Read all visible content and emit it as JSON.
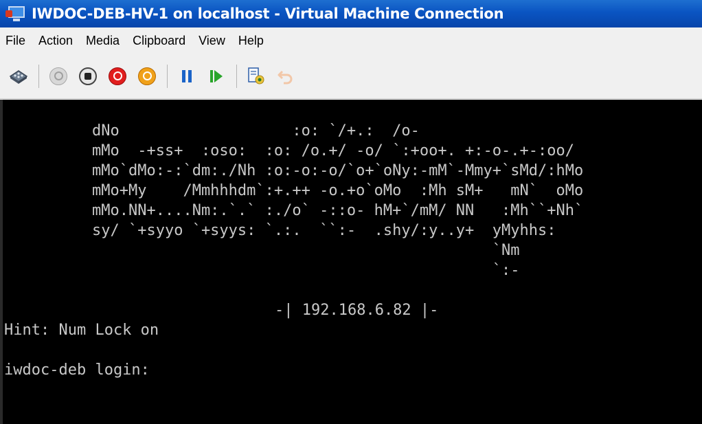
{
  "window": {
    "title": "IWDOC-DEB-HV-1 on localhost - Virtual Machine Connection",
    "icon": "vm-connection-icon"
  },
  "menu": [
    "File",
    "Action",
    "Media",
    "Clipboard",
    "View",
    "Help"
  ],
  "toolbar": {
    "buttons": [
      {
        "name": "ctrl-alt-del-button",
        "icon": "keyboard-icon"
      },
      {
        "name": "start-button",
        "icon": "start-icon",
        "enabled": false
      },
      {
        "name": "turn-off-button",
        "icon": "stop-icon"
      },
      {
        "name": "shut-down-button",
        "icon": "shutdown-icon"
      },
      {
        "name": "save-button",
        "icon": "save-icon"
      },
      {
        "name": "pause-button",
        "icon": "pause-icon"
      },
      {
        "name": "reset-button",
        "icon": "reset-icon"
      },
      {
        "name": "snapshot-button",
        "icon": "snapshot-icon"
      },
      {
        "name": "revert-button",
        "icon": "revert-icon"
      }
    ],
    "colors": {
      "red": "#e11e1e",
      "orange": "#f0a11a",
      "blue": "#1a63c8",
      "green": "#29a52a"
    }
  },
  "console": {
    "banner": [
      "dNo                   :o: `/+.:  /o-",
      "mMo  -+ss+  :oso:  :o: /o.+/ -o/ `:+oo+. +:-o-.+-:oo/",
      "mMo`dMo:-:`dm:./Nh :o:-o:-o/`o+`oNy:-mM`-Mmy+`sMd/:hMo",
      "mMo+My    /Mmhhhdm`:+.++ -o.+o`oMo  :Mh sM+   mN`  oMo",
      "mMo.NN+....Nm:.`.` :./o` -::o- hM+`/mM/ NN   :Mh``+Nh`",
      "sy/ `+syyo `+syys: `.:.  ``:-  .shy/:y..y+  yMyhhs:",
      "                                            `Nm",
      "                                            `:-"
    ],
    "ip_line": "-| 192.168.6.82 |-",
    "hint": "Hint: Num Lock on",
    "login_prompt": "iwdoc-deb login:"
  }
}
